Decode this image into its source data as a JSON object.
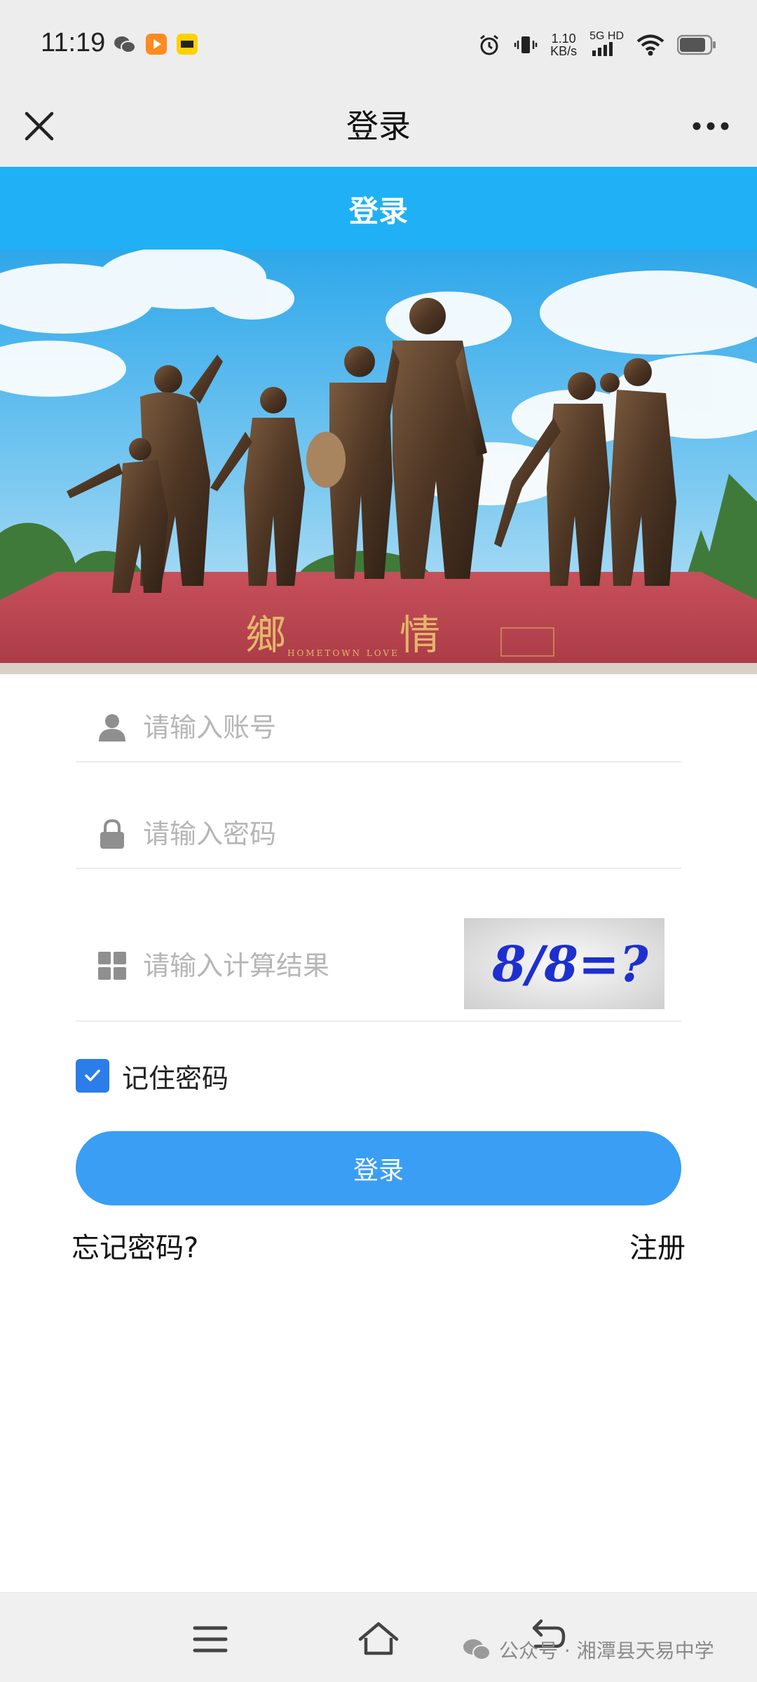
{
  "status_bar": {
    "time": "11:19",
    "net_speed_value": "1.10",
    "net_speed_unit": "KB/s",
    "net_type": "5G HD"
  },
  "nav": {
    "title": "登录"
  },
  "header": {
    "title": "登录"
  },
  "hero": {
    "monument_text_1": "鄉",
    "monument_text_2": "情",
    "monument_subtext": "HOMETOWN LOVE"
  },
  "form": {
    "account_placeholder": "请输入账号",
    "password_placeholder": "请输入密码",
    "captcha_placeholder": "请输入计算结果",
    "captcha_text": "8/8=?",
    "remember_label": "记住密码",
    "remember_checked": true
  },
  "actions": {
    "login_label": "登录",
    "forgot_label": "忘记密码?",
    "register_label": "注册"
  },
  "watermark": {
    "text": "公众号 · 湘潭县天易中学"
  },
  "colors": {
    "header_blue": "#1fb0f5",
    "button_blue": "#3a9ef4",
    "checkbox_blue": "#2b7de9"
  }
}
